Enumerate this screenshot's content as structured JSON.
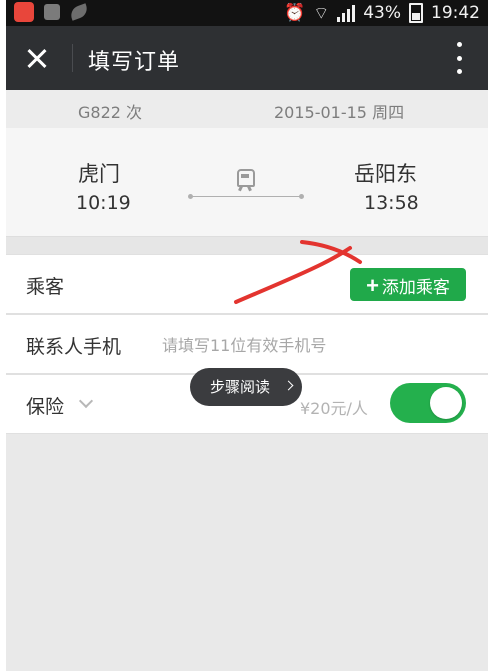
{
  "status_bar": {
    "battery": "43%",
    "time": "19:42"
  },
  "header": {
    "title": "填写订单"
  },
  "train": {
    "number": "G822 次",
    "date": "2015-01-15 周四",
    "from_station": "虎门",
    "depart_time": "10:19",
    "to_station": "岳阳东",
    "arrive_time": "13:58"
  },
  "form": {
    "passenger_label": "乘客",
    "add_passenger": "添加乘客",
    "contact_label": "联系人手机",
    "contact_placeholder": "请填写11位有效手机号",
    "insurance_label": "保险",
    "insurance_price": "¥20元/人",
    "insurance_on": true
  },
  "toast": {
    "text": "步骤阅读"
  },
  "colors": {
    "accent_green": "#24b04d",
    "header_bg": "#2e3033",
    "annotation": "#e3342f"
  }
}
